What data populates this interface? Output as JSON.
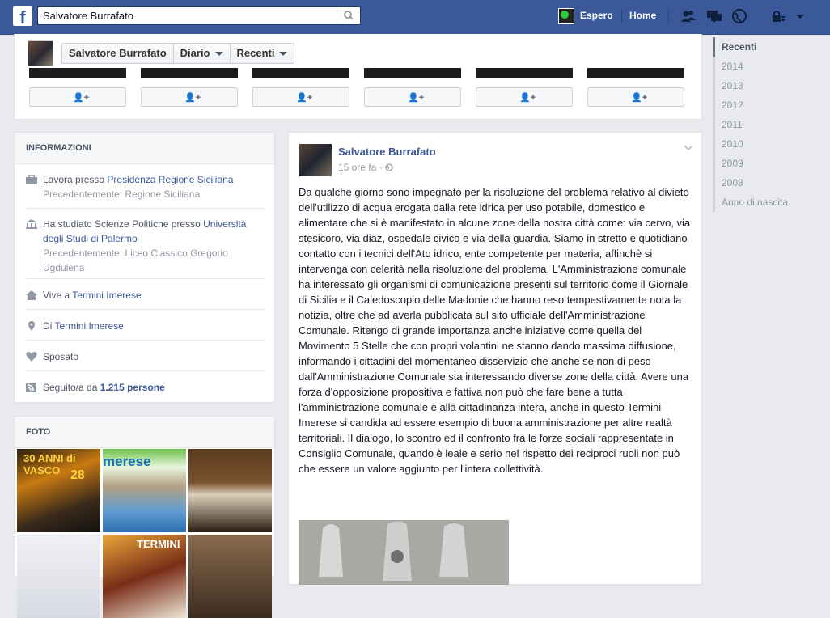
{
  "topbar": {
    "search_value": "Salvatore Burrafato",
    "user_name": "Espero",
    "home_label": "Home"
  },
  "profile_nav": {
    "name": "Salvatore Burrafato",
    "diario": "Diario",
    "recenti": "Recenti"
  },
  "years": [
    "Recenti",
    "2014",
    "2013",
    "2012",
    "2011",
    "2010",
    "2009",
    "2008",
    "Anno di nascita"
  ],
  "info": {
    "title": "INFORMAZIONI",
    "work_prefix": "Lavora presso ",
    "work_link": "Presidenza Regione Siciliana",
    "work_prev": "Precedentemente: Regione Siciliana",
    "study_prefix": "Ha studiato Scienze Politiche presso ",
    "study_link": "Università degli Studi di Palermo",
    "study_prev": "Precedentemente: Liceo Classico Gregorio Ugdulena",
    "lives_prefix": "Vive a ",
    "lives_link": "Termini Imerese",
    "from_prefix": "Di ",
    "from_link": "Termini Imerese",
    "relationship": "Sposato",
    "followers_prefix": "Seguito/a da ",
    "followers_count": "1.215 persone"
  },
  "photos": {
    "title": "FOTO",
    "p1_text": "30 ANNI di VASCO",
    "p1_sub": "28",
    "p2_text": "merese",
    "p5_text": "TERMINI"
  },
  "post": {
    "author": "Salvatore Burrafato",
    "time": "15 ore fa · ",
    "text": "Da qualche giorno sono impegnato per la risoluzione del problema relativo al divieto dell'utilizzo di acqua erogata dalla rete idrica per uso potabile, domestico e alimentare che si è manifestato in alcune zone della nostra città come: via cervo, via stesicoro, via diaz, ospedale civico e via della guardia. Siamo in stretto e quotidiano contatto con i tecnici dell'Ato idrico, ente competente per materia, affinchè si intervenga con celerità nella risoluzione del problema. L'Amministrazione comunale ha interessato gli organismi di comunicazione presenti sul territorio come il Giornale di Sicilia e il Caledoscopio delle Madonie che hanno reso tempestivamente nota la notizia, oltre che ad averla pubblicata sul sito ufficiale dell'Amministrazione Comunale. Ritengo di grande importanza anche iniziative come quella del Movimento 5 Stelle che con propri volantini ne stanno dando massima diffusione, informando i cittadini del momentaneo disservizio che anche se non di peso dall'Amministrazione Comunale sta interessando diverse zone della città. Avere una forza d'opposizione propositiva e fattiva non può che fare bene a tutta l'amministrazione comunale e alla cittadinanza intera, anche in questo Termini Imerese si candida ad essere esempio di buona amministrazione per altre realtà territoriali. Il dialogo, lo scontro ed il confronto fra le forze sociali rappresentate in Consiglio Comunale, quando è leale e serio nel rispetto dei reciproci ruoli non può che essere un valore aggiunto per l'intera collettività."
  },
  "colors": {
    "brand": "#3b5998",
    "link": "#3b5998",
    "muted": "#9197a3",
    "background": "#e9eaed"
  },
  "icons": [
    "search-icon",
    "friends-icon",
    "messages-icon",
    "globe-icon",
    "lock-icon",
    "settings-caret-icon",
    "briefcase-icon",
    "school-icon",
    "house-icon",
    "location-pin-icon",
    "heart-icon",
    "feed-icon",
    "add-friend-icon",
    "chevron-down-icon"
  ]
}
